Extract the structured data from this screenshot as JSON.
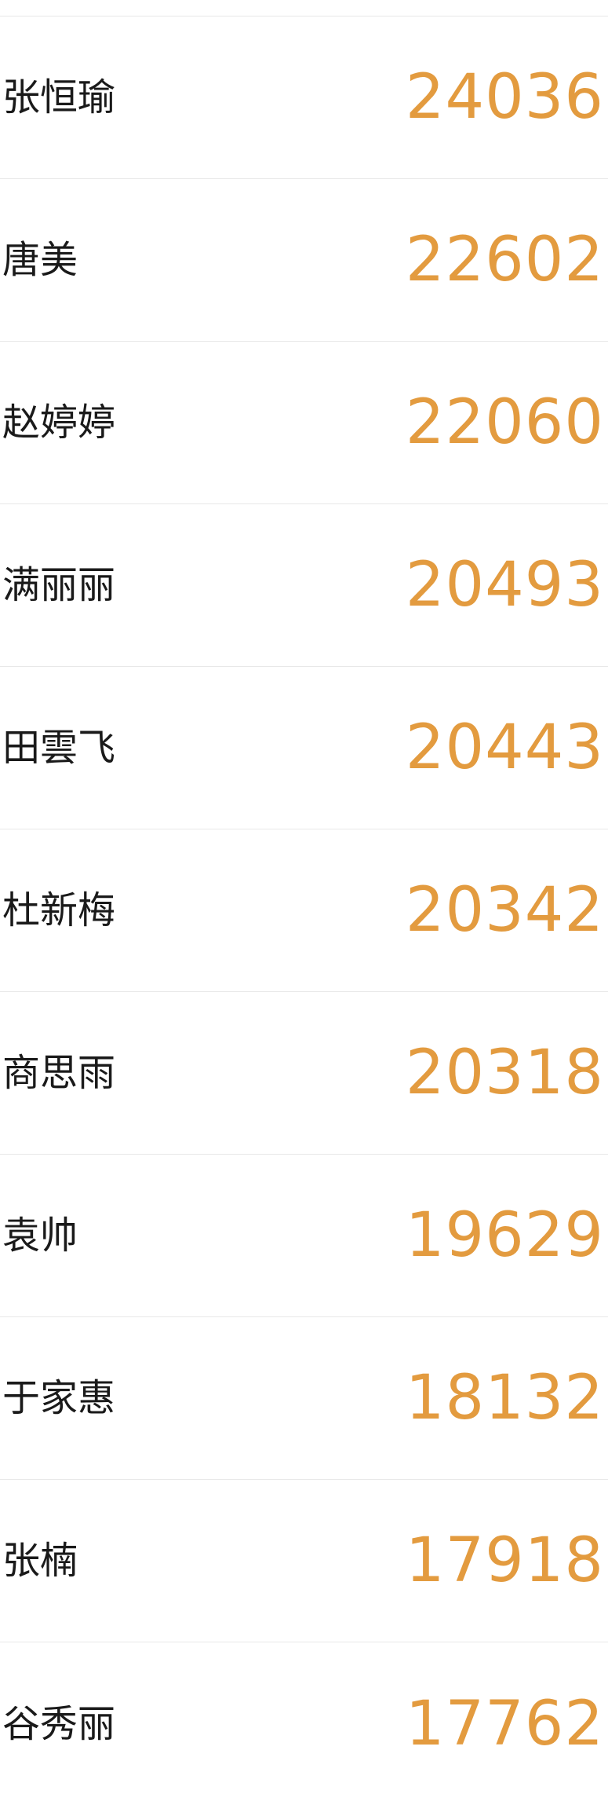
{
  "colors": {
    "score": "#e39b3f",
    "name": "#1a1a1a",
    "divider": "#e8e8e8",
    "background": "#ffffff"
  },
  "rows": [
    {
      "name": "张恒瑜",
      "score": "24036"
    },
    {
      "name": "唐美",
      "score": "22602"
    },
    {
      "name": "赵婷婷",
      "score": "22060"
    },
    {
      "name": "满丽丽",
      "score": "20493"
    },
    {
      "name": "田雲飞",
      "score": "20443"
    },
    {
      "name": "杜新梅",
      "score": "20342"
    },
    {
      "name": "商思雨",
      "score": "20318"
    },
    {
      "name": "袁帅",
      "score": "19629"
    },
    {
      "name": "于家惠",
      "score": "18132"
    },
    {
      "name": "张楠",
      "score": "17918"
    },
    {
      "name": "谷秀丽",
      "score": "17762"
    }
  ]
}
